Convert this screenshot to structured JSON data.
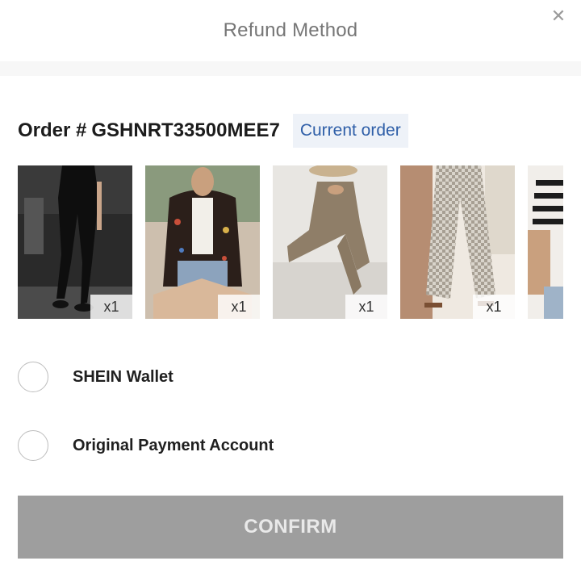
{
  "header": {
    "title": "Refund Method",
    "close_glyph": "✕"
  },
  "order": {
    "label": "Order #",
    "number": "GSHNRT33500MEE7",
    "badge": "Current order"
  },
  "products": [
    {
      "quantity": "x1",
      "image": "black-leggings-photo"
    },
    {
      "quantity": "x1",
      "image": "embroidered-vest-photo"
    },
    {
      "quantity": "x1",
      "image": "tan-jumpsuit-photo"
    },
    {
      "quantity": "x1",
      "image": "geometric-wide-pants-photo"
    },
    {
      "quantity": "",
      "image": "striped-top-photo"
    }
  ],
  "refund_options": [
    {
      "label": "SHEIN Wallet",
      "selected": false
    },
    {
      "label": "Original Payment Account",
      "selected": false
    }
  ],
  "confirm": {
    "label": "CONFIRM"
  },
  "colors": {
    "badge_bg": "#eef2f8",
    "badge_text": "#2f5fa8",
    "confirm_disabled": "#9e9e9e"
  }
}
